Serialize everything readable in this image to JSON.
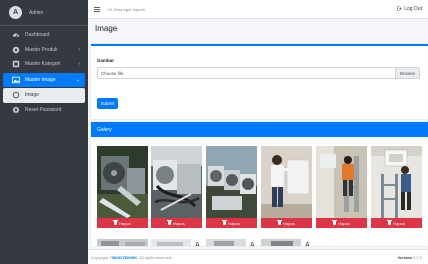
{
  "sidebar": {
    "brand": "Admin",
    "logo_letter": "A",
    "items": [
      {
        "label": "Dashboard",
        "icon": "tachometer-icon"
      },
      {
        "label": "Master Produk",
        "icon": "cog-icon",
        "chevron": "‹"
      },
      {
        "label": "Master Kategori",
        "icon": "tag-icon",
        "chevron": "‹"
      },
      {
        "label": "Master Image",
        "icon": "image-icon",
        "chevron": "⌄"
      },
      {
        "label": "Image",
        "icon": "circle-icon"
      },
      {
        "label": "Reset Password",
        "icon": "gear-icon"
      }
    ]
  },
  "topbar": {
    "greeting": "Hi, Dina Agni Saputri",
    "logout": "Log Out"
  },
  "page": {
    "title": "Image"
  },
  "form": {
    "field_label": "Gambar",
    "file_placeholder": "Choose file",
    "browse_label": "Browse",
    "submit_label": "Submit"
  },
  "gallery": {
    "title": "Galery",
    "delete_label": "Hapus",
    "items": [
      {
        "photo": "outdoor-ac-units"
      },
      {
        "photo": "ac-pipes-tangle"
      },
      {
        "photo": "ac-units-rooftop"
      },
      {
        "photo": "technician-white-shirt"
      },
      {
        "photo": "technician-orange-shirt"
      },
      {
        "photo": "technician-on-ladder"
      }
    ]
  },
  "footer": {
    "copyright_prefix": "Copyright ©",
    "brand": "BIODTEKNIK",
    "rights": ". All rights reserved.",
    "version_label": "Version",
    "version_value": "3.2.0"
  },
  "colors": {
    "primary": "#007bff",
    "danger": "#dc3545",
    "sidebar": "#343a40"
  }
}
